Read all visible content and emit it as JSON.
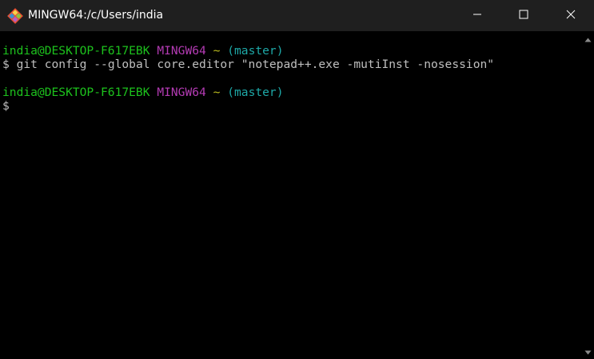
{
  "window": {
    "title": "MINGW64:/c/Users/india",
    "icon": "git-bash-icon",
    "controls": {
      "minimize_icon": "minimize-icon",
      "maximize_icon": "maximize-icon",
      "close_icon": "close-icon"
    }
  },
  "terminal": {
    "lines": [
      {
        "type": "prompt",
        "user_host": "india@DESKTOP-F617EBK",
        "env": "MINGW64",
        "path": "~",
        "branch": "(master)"
      },
      {
        "type": "command",
        "symbol": "$",
        "text": "git config --global core.editor \"notepad++.exe -mutiInst -nosession\""
      },
      {
        "type": "prompt",
        "user_host": "india@DESKTOP-F617EBK",
        "env": "MINGW64",
        "path": "~",
        "branch": "(master)"
      },
      {
        "type": "command",
        "symbol": "$",
        "text": ""
      }
    ]
  },
  "colors": {
    "user_host": "#1dc21d",
    "env": "#b43bb4",
    "path": "#bcbc1f",
    "branch": "#1ea9a8",
    "text": "#bfbfbf",
    "background": "#000000",
    "titlebar": "#1f1f1f"
  }
}
